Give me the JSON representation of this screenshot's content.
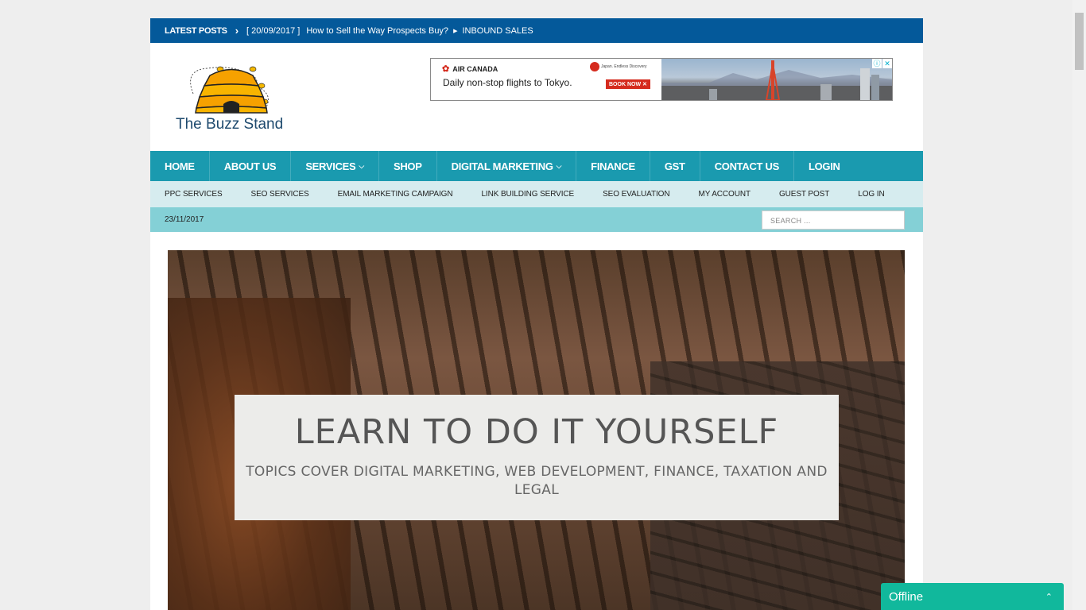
{
  "ticker": {
    "label": "LATEST POSTS",
    "date": "[ 20/09/2017 ]",
    "title": "How to Sell the Way Prospects Buy?",
    "category": "INBOUND SALES"
  },
  "site": {
    "name": "The Buzz Stand"
  },
  "ad": {
    "brand": "AIR CANADA",
    "text": "Daily non-stop flights to Tokyo.",
    "tagline": "Japan. Endless Discovery",
    "cta": "BOOK NOW"
  },
  "main_nav": [
    {
      "label": "HOME",
      "dropdown": false
    },
    {
      "label": "ABOUT US",
      "dropdown": false
    },
    {
      "label": "SERVICES",
      "dropdown": true
    },
    {
      "label": "SHOP",
      "dropdown": false
    },
    {
      "label": "DIGITAL MARKETING",
      "dropdown": true
    },
    {
      "label": "FINANCE",
      "dropdown": false
    },
    {
      "label": "GST",
      "dropdown": false
    },
    {
      "label": "CONTACT US",
      "dropdown": false
    },
    {
      "label": "LOGIN",
      "dropdown": false
    }
  ],
  "sub_nav": [
    "PPC SERVICES",
    "SEO SERVICES",
    "EMAIL MARKETING CAMPAIGN",
    "LINK BUILDING SERVICE",
    "SEO EVALUATION",
    "MY ACCOUNT",
    "GUEST POST",
    "LOG IN"
  ],
  "date_bar": {
    "date": "23/11/2017",
    "search_placeholder": "SEARCH ..."
  },
  "hero": {
    "title": "LEARN TO DO IT YOURSELF",
    "subtitle": "TOPICS COVER DIGITAL MARKETING, WEB DEVELOPMENT, FINANCE, TAXATION AND LEGAL"
  },
  "chat": {
    "status": "Offline"
  },
  "colors": {
    "ticker_bg": "#04599a",
    "nav_bg": "#1a9aaf",
    "subnav_bg": "#d6ecef",
    "datebar_bg": "#84d0d6",
    "chat_bg": "#11b89c"
  },
  "icons": {
    "ticker_arrow": "chevron-right-icon",
    "dropdown": "chevron-down-icon",
    "chat_toggle": "chevron-up-icon"
  }
}
